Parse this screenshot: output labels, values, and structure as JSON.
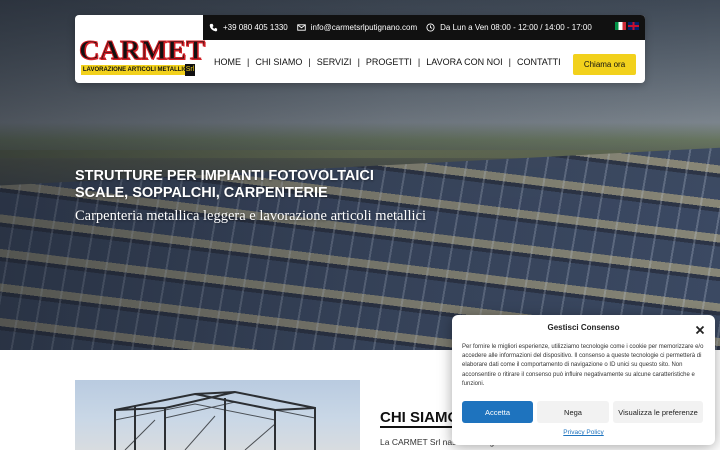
{
  "header": {
    "logo_text": "CARMET",
    "logo_tagline": "LAVORAZIONE ARTICOLI METALLICI",
    "logo_badge": "Srl",
    "topbar": {
      "phone": "+39 080 405 1330",
      "email": "info@carmetsrlputignano.com",
      "hours": "Da Lun a Ven 08:00 - 12:00 / 14:00 - 17:00"
    },
    "languages": [
      "it",
      "en"
    ],
    "nav": [
      {
        "label": "HOME"
      },
      {
        "label": "CHI SIAMO"
      },
      {
        "label": "SERVIZI"
      },
      {
        "label": "PROGETTI"
      },
      {
        "label": "LAVORA CON NOI"
      },
      {
        "label": "CONTATTI"
      }
    ],
    "nav_separator": "|",
    "call_button": "Chiama ora"
  },
  "hero": {
    "title_line1": "STRUTTURE PER IMPIANTI FOTOVOLTAICI",
    "title_line2": "SCALE, SOPPALCHI, CARPENTERIE",
    "subtitle": "Carpenteria metallica leggera e lavorazione articoli metallici"
  },
  "about": {
    "title": "CHI SIAMO",
    "text": "La CARMET Srl nasce a Putignano..."
  },
  "consent": {
    "title": "Gestisci Consenso",
    "body": "Per fornire le migliori esperienze, utilizziamo tecnologie come i cookie per memorizzare e/o accedere alle informazioni del dispositivo. Il consenso a queste tecnologie ci permetterà di elaborare dati come il comportamento di navigazione o ID unici su questo sito. Non acconsentire o ritirare il consenso può influire negativamente su alcune caratteristiche e funzioni.",
    "accept": "Accetta",
    "deny": "Nega",
    "preferences": "Visualizza le preferenze",
    "privacy_link": "Privacy Policy"
  },
  "colors": {
    "accent_yellow": "#f2d11c",
    "topbar_bg": "#111111",
    "accept_blue": "#1e73be"
  }
}
